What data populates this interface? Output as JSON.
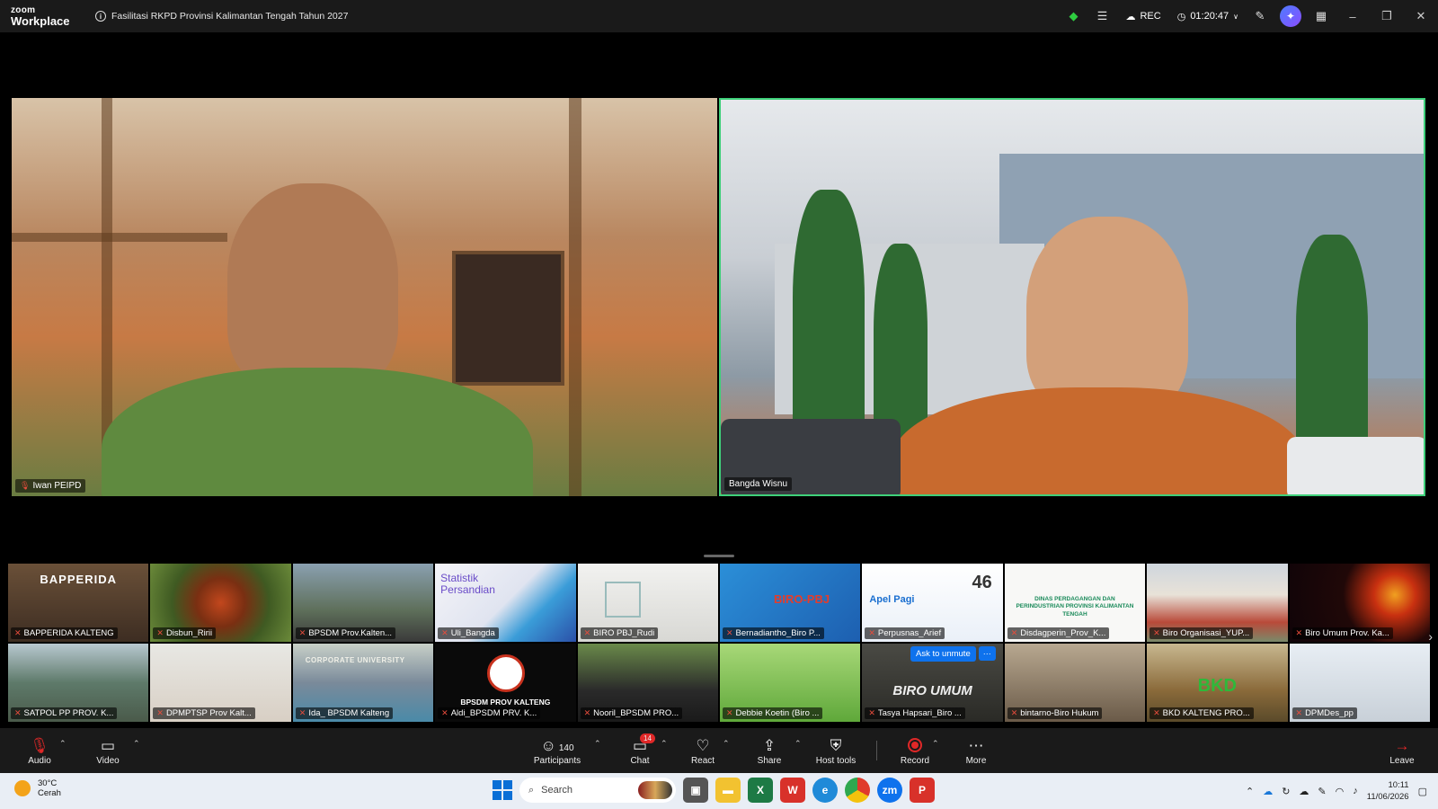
{
  "titlebar": {
    "brand_line1": "zoom",
    "brand_line2": "Workplace",
    "meeting_title": "Fasilitasi RKPD Provinsi Kalimantan Tengah Tahun 2027",
    "rec_label": "REC",
    "timer": "01:20:47"
  },
  "main_videos": [
    {
      "name": "Iwan PEIPD"
    },
    {
      "name": "Bangda Wisnu"
    }
  ],
  "gallery": {
    "tiles": [
      {
        "name": "BAPPERIDA KALTENG"
      },
      {
        "name": "Disbun_Ririi"
      },
      {
        "name": "BPSDM Prov.Kalten..."
      },
      {
        "name": "Uli_Bangda"
      },
      {
        "name": "BIRO PBJ_Rudi"
      },
      {
        "name": "Bernadiantho_Biro P..."
      },
      {
        "name": "Perpusnas_Arief"
      },
      {
        "name": "Disdagperin_Prov_K..."
      },
      {
        "name": "Biro Organisasi_YUP..."
      },
      {
        "name": "Biro Umum Prov. Ka..."
      },
      {
        "name": "SATPOL PP PROV. K..."
      },
      {
        "name": "DPMPTSP Prov Kalt..."
      },
      {
        "name": "Ida_ BPSDM Kalteng"
      },
      {
        "name": "Aldi_BPSDM PRV. K..."
      },
      {
        "name": "Nooril_BPSDM PRO..."
      },
      {
        "name": "Debbie Koetin (Biro ..."
      },
      {
        "name": "Tasya Hapsari_Biro ..."
      },
      {
        "name": "bintarno-Biro Hukum"
      },
      {
        "name": "BKD KALTENG PRO..."
      },
      {
        "name": "DPMDes_pp"
      }
    ],
    "tile_texts": {
      "bapperida": "BAPPERIDA",
      "bpsdm": "BPSDM PROV KALTENG",
      "biro_umum": "BIRO UMUM",
      "bkd": "BKD",
      "statistik": "Statistik Persandian",
      "apel": "Apel Pagi",
      "perpusnas": "46",
      "disdag": "DINAS PERDAGANGAN DAN PERINDUSTRIAN PROVINSI KALIMANTAN TENGAH",
      "corporate": "CORPORATE UNIVERSITY",
      "biro_pbj": "BIRO-PBJ"
    },
    "ask_unmute": "Ask to unmute",
    "ask_more": "···"
  },
  "toolbar": {
    "audio": "Audio",
    "video": "Video",
    "participants": "Participants",
    "participant_count": "140",
    "chat": "Chat",
    "chat_badge": "14",
    "react": "React",
    "share": "Share",
    "host_tools": "Host tools",
    "record": "Record",
    "more": "More",
    "leave": "Leave"
  },
  "taskbar": {
    "temp": "30°C",
    "weather": "Cerah",
    "search_placeholder": "Search",
    "time": "10:11",
    "date": "11/06/2026"
  },
  "colors": {
    "active_speaker_border": "#3fd07a",
    "zoom_blue": "#0e72ed",
    "record_red": "#e02828"
  }
}
